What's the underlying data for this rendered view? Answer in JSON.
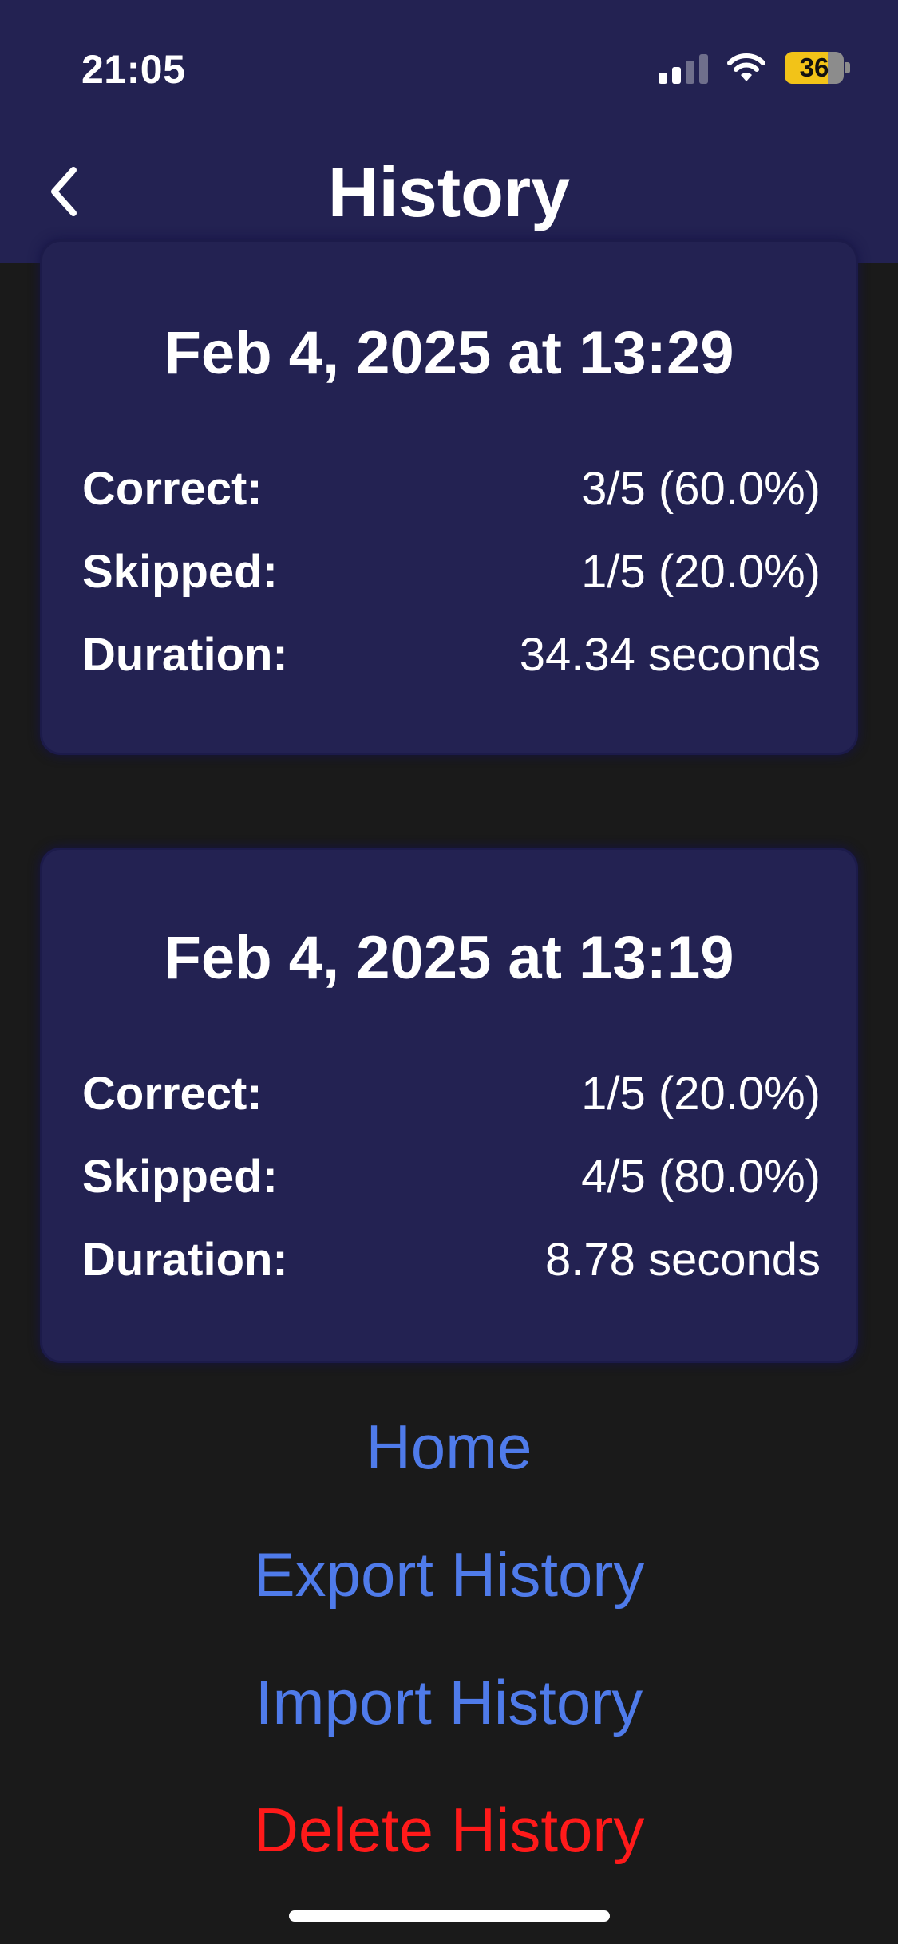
{
  "status_bar": {
    "time": "21:05",
    "battery_level": "36",
    "icons": [
      "signal-icon",
      "wifi-icon",
      "battery-icon"
    ]
  },
  "header": {
    "title": "History",
    "back_icon": "chevron-left-icon"
  },
  "history": [
    {
      "date": "Feb 4, 2025 at 13:29",
      "correct_label": "Correct:",
      "correct_value": "3/5 (60.0%)",
      "skipped_label": "Skipped:",
      "skipped_value": "1/5 (20.0%)",
      "duration_label": "Duration:",
      "duration_value": "34.34 seconds"
    },
    {
      "date": "Feb 4, 2025 at 13:19",
      "correct_label": "Correct:",
      "correct_value": "1/5 (20.0%)",
      "skipped_label": "Skipped:",
      "skipped_value": "4/5 (80.0%)",
      "duration_label": "Duration:",
      "duration_value": "8.78 seconds"
    }
  ],
  "actions": {
    "home": "Home",
    "export": "Export History",
    "import": "Import History",
    "delete": "Delete History"
  },
  "colors": {
    "header_background": "#232252",
    "card_background": "#232252",
    "page_background": "#1a1a1a",
    "link_color": "#4f7bea",
    "danger_color": "#ff1a1a",
    "battery_color": "#f2c318"
  }
}
